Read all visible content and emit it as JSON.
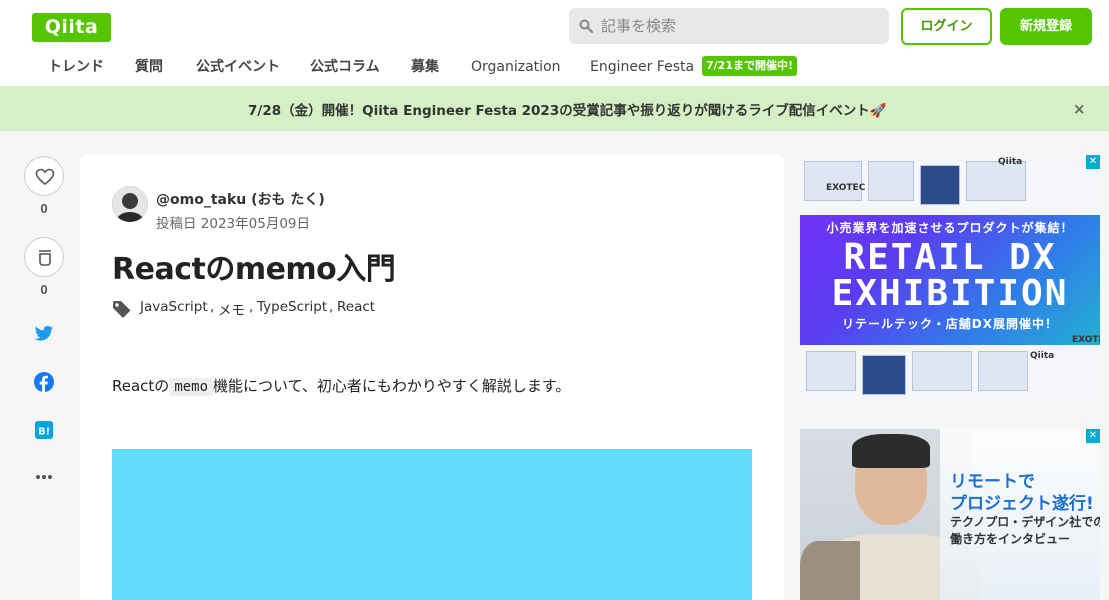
{
  "header": {
    "logo": "Qiita",
    "search_placeholder": "記事を検索",
    "login_label": "ログイン",
    "signup_label": "新規登録"
  },
  "nav": {
    "items": [
      "トレンド",
      "質問",
      "公式イベント",
      "公式コラム",
      "募集",
      "Organization",
      "Engineer Festa"
    ],
    "badge": "7/21まで開催中!"
  },
  "banner": {
    "text": "7/28（金）開催！Qiita Engineer Festa 2023の受賞記事や振り返りが聞けるライブ配信イベント🚀",
    "close": "×"
  },
  "side_actions": {
    "like_count": "0",
    "stock_count": "0",
    "icons": [
      "heart-icon",
      "stock-icon",
      "twitter-icon",
      "facebook-icon",
      "hatena-bookmark-icon",
      "more-icon"
    ]
  },
  "article": {
    "author": "@omo_taku (おも たく)",
    "posted": "投稿日 2023年05月09日",
    "title": "Reactのmemo入門",
    "tags": [
      "JavaScript",
      "メモ",
      "TypeScript",
      "React"
    ],
    "tag_separator": ",",
    "body_prefix": "Reactの",
    "body_code": "memo",
    "body_suffix": "機能について、初心者にもわかりやすく解説します。"
  },
  "ads": {
    "ad1": {
      "line1": "小売業界を加速させるプロダクトが集結！",
      "big1": "RETAIL DX",
      "big2": "EXHIBITION",
      "line2": "リテールテック・店舗DX展開催中！",
      "brands": [
        "EXOTEC",
        "Qiita",
        "EXOTE",
        "Qiita"
      ]
    },
    "ad2": {
      "headline1": "リモートで",
      "headline2": "プロジェクト遂行!",
      "sub1": "テクノプロ・デザイン社での",
      "sub2": "働き方をインタビュー"
    }
  },
  "colors": {
    "brand": "#55c500",
    "banner_bg": "#d6f0c6",
    "react_hero": "#61dafb",
    "twitter": "#1d9bf0",
    "facebook": "#1877f2",
    "hatena": "#00a4de"
  }
}
